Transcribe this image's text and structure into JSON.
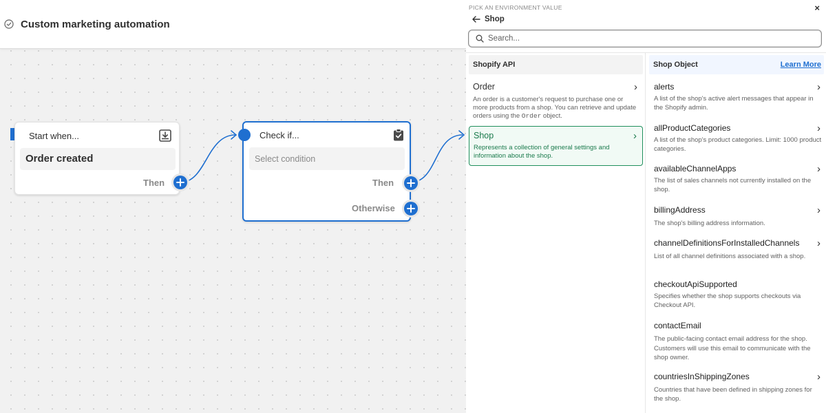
{
  "workflow": {
    "title": "Custom marketing automation",
    "trigger": {
      "heading": "Start when...",
      "value": "Order created",
      "then_label": "Then"
    },
    "condition": {
      "heading": "Check if...",
      "placeholder": "Select condition",
      "then_label": "Then",
      "otherwise_label": "Otherwise"
    }
  },
  "picker": {
    "overline": "PICK AN ENVIRONMENT VALUE",
    "back_label": "Shop",
    "search_placeholder": "Search...",
    "close_label": "×",
    "left_column": {
      "header": "Shopify API",
      "items": [
        {
          "name": "Order",
          "description_pre": "An order is a customer's request to purchase one or more products from a shop. You can retrieve and update orders using the ",
          "description_code": "Order",
          "description_post": " object.",
          "selected": false
        },
        {
          "name": "Shop",
          "description": "Represents a collection of general settings and information about the shop.",
          "selected": true
        }
      ]
    },
    "right_column": {
      "header": "Shop Object",
      "learn_more": "Learn More",
      "fields": [
        {
          "name": "alerts",
          "description": "A list of the shop's active alert messages that appear in the Shopify admin.",
          "has_children": true
        },
        {
          "name": "allProductCategories",
          "description": "A list of the shop's product categories. Limit: 1000 product categories.",
          "has_children": true
        },
        {
          "name": "availableChannelApps",
          "description": "The list of sales channels not currently installed on the shop.",
          "has_children": true
        },
        {
          "name": "billingAddress",
          "description": "The shop's billing address information.",
          "has_children": true
        },
        {
          "name": "channelDefinitionsForInstalledChannels",
          "description": "List of all channel definitions associated with a shop.",
          "has_children": true
        },
        {
          "name": "checkoutApiSupported",
          "description": "Specifies whether the shop supports checkouts via Checkout API.",
          "has_children": false
        },
        {
          "name": "contactEmail",
          "description": "The public-facing contact email address for the shop. Customers will use this email to communicate with the shop owner.",
          "has_children": false
        },
        {
          "name": "countriesInShippingZones",
          "description": "Countries that have been defined in shipping zones for the shop.",
          "has_children": true
        }
      ]
    }
  },
  "colors": {
    "accent": "#1f6fd0",
    "selected_green": "#1a7a4c"
  },
  "icons": [
    "check-circle-icon",
    "download-icon",
    "clipboard-check-icon",
    "arrow-left-icon",
    "search-icon",
    "chevron-right-icon",
    "plus-icon",
    "close-icon"
  ]
}
